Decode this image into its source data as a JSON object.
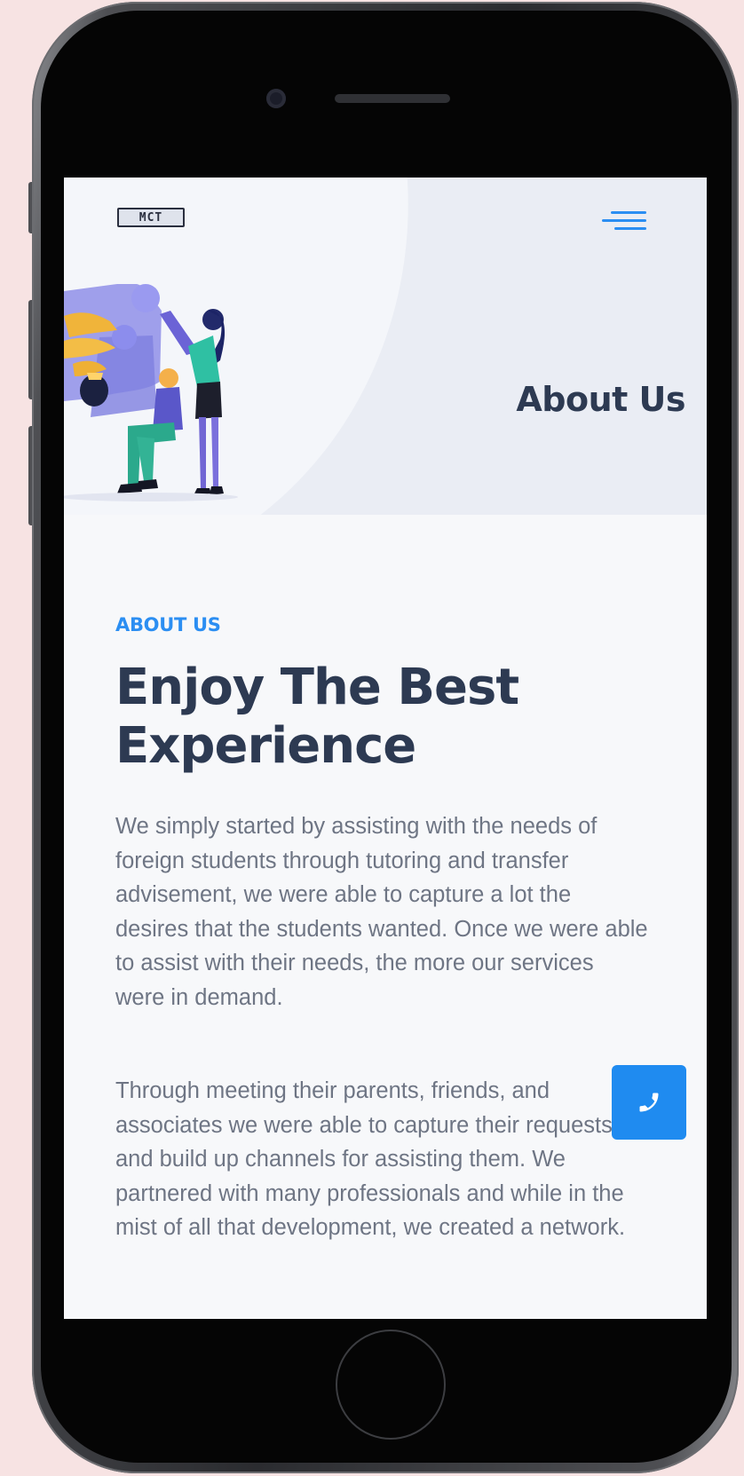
{
  "header": {
    "logo_text": "MCT",
    "menu_icon": "hamburger-menu-icon"
  },
  "hero": {
    "title": "About Us",
    "illustration": "teamwork-puzzle-illustration"
  },
  "about": {
    "eyebrow": "ABOUT US",
    "title_line_1": "Enjoy The Best",
    "title_line_2": "Experience",
    "paragraph_1": "We simply started by assisting with the needs of foreign students through tutoring and transfer advisement, we were able to capture a lot the desires that the students wanted.  Once we were able to assist with their needs, the more our services were in demand.",
    "paragraph_2": "Through meeting their parents, friends, and associates we were able to capture their requests and build up channels for assisting them.  We partnered with many professionals and while in the mist of all that development, we created a network."
  },
  "floating": {
    "call_icon": "phone-icon"
  },
  "colors": {
    "accent": "#2b8ef2",
    "heading": "#2d3a52",
    "body_text": "#6e7584",
    "hero_bg": "#eaedf4",
    "page_bg": "#f7f8fa",
    "backdrop": "#f7e3e3"
  }
}
